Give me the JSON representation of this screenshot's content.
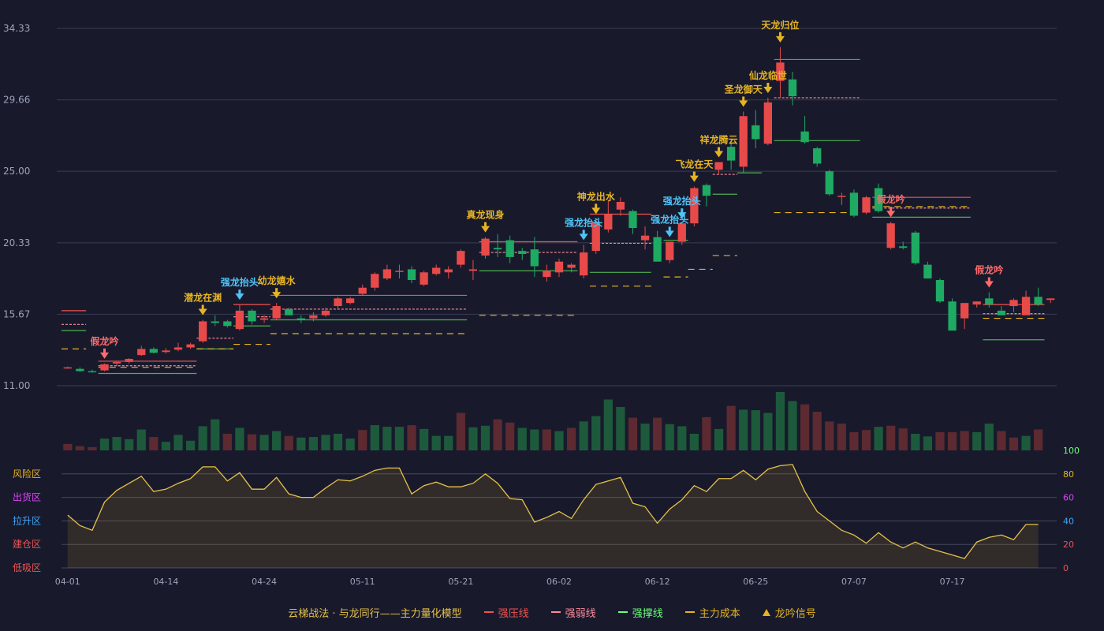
{
  "chart_data": {
    "type": "candlestick",
    "dates": [
      "04-01",
      "04-02",
      "04-03",
      "04-07",
      "04-08",
      "04-09",
      "04-10",
      "04-11",
      "04-14",
      "04-15",
      "04-16",
      "04-17",
      "04-18",
      "04-21",
      "04-22",
      "04-23",
      "04-24",
      "04-25",
      "04-28",
      "04-29",
      "04-30",
      "05-06",
      "05-07",
      "05-08",
      "05-09",
      "05-11",
      "05-12",
      "05-13",
      "05-14",
      "05-15",
      "05-16",
      "05-19",
      "05-20",
      "05-21",
      "05-22",
      "05-23",
      "05-26",
      "05-27",
      "05-28",
      "05-29",
      "05-30",
      "06-02",
      "06-03",
      "06-04",
      "06-05",
      "06-06",
      "06-09",
      "06-10",
      "06-11",
      "06-12",
      "06-13",
      "06-16",
      "06-17",
      "06-18",
      "06-19",
      "06-20",
      "06-23",
      "06-24",
      "06-25",
      "06-26",
      "06-27",
      "06-30",
      "07-01",
      "07-02",
      "07-03",
      "07-04",
      "07-07",
      "07-08",
      "07-09",
      "07-10",
      "07-11",
      "07-14",
      "07-15",
      "07-16",
      "07-17",
      "07-18",
      "07-21",
      "07-22",
      "07-23",
      "07-24",
      "07-25"
    ],
    "x_ticks": [
      {
        "i": 0,
        "label": "04-01"
      },
      {
        "i": 8,
        "label": "04-14"
      },
      {
        "i": 16,
        "label": "04-24"
      },
      {
        "i": 24,
        "label": "05-11"
      },
      {
        "i": 32,
        "label": "05-21"
      },
      {
        "i": 40,
        "label": "06-02"
      },
      {
        "i": 48,
        "label": "06-12"
      },
      {
        "i": 56,
        "label": "06-25"
      },
      {
        "i": 64,
        "label": "07-07"
      },
      {
        "i": 72,
        "label": "07-17"
      }
    ],
    "ohlc": [
      [
        12.2,
        12.25,
        12.1,
        12.2
      ],
      [
        12.1,
        12.2,
        11.9,
        11.95
      ],
      [
        11.95,
        12.05,
        11.85,
        11.9
      ],
      [
        12.0,
        12.45,
        11.95,
        12.4
      ],
      [
        12.45,
        12.6,
        12.3,
        12.55
      ],
      [
        12.55,
        12.8,
        12.45,
        12.75
      ],
      [
        13.0,
        13.6,
        12.95,
        13.4
      ],
      [
        13.4,
        13.5,
        13.1,
        13.15
      ],
      [
        13.2,
        13.45,
        13.1,
        13.3
      ],
      [
        13.35,
        13.8,
        13.25,
        13.5
      ],
      [
        13.5,
        13.8,
        13.4,
        13.7
      ],
      [
        13.9,
        15.3,
        13.8,
        15.2
      ],
      [
        15.2,
        15.6,
        14.9,
        15.1
      ],
      [
        15.2,
        15.3,
        14.8,
        14.9
      ],
      [
        14.7,
        16.3,
        14.6,
        15.9
      ],
      [
        15.9,
        16.0,
        15.0,
        15.2
      ],
      [
        15.3,
        15.6,
        15.1,
        15.4
      ],
      [
        15.4,
        16.4,
        15.3,
        16.2
      ],
      [
        16.0,
        16.1,
        15.6,
        15.6
      ],
      [
        15.4,
        15.6,
        15.1,
        15.3
      ],
      [
        15.4,
        15.8,
        15.2,
        15.6
      ],
      [
        15.6,
        16.1,
        15.5,
        15.9
      ],
      [
        16.2,
        16.8,
        16.0,
        16.7
      ],
      [
        16.4,
        16.8,
        16.3,
        16.7
      ],
      [
        17.0,
        17.6,
        16.9,
        17.4
      ],
      [
        17.4,
        18.4,
        17.2,
        18.3
      ],
      [
        18.0,
        18.9,
        17.9,
        18.6
      ],
      [
        18.5,
        18.9,
        18.0,
        18.5
      ],
      [
        18.6,
        18.8,
        17.7,
        17.9
      ],
      [
        17.6,
        18.5,
        17.5,
        18.4
      ],
      [
        18.3,
        18.9,
        18.2,
        18.7
      ],
      [
        18.4,
        18.8,
        18.0,
        18.6
      ],
      [
        18.9,
        19.9,
        18.7,
        19.8
      ],
      [
        18.5,
        19.2,
        17.9,
        18.6
      ],
      [
        19.5,
        20.7,
        19.3,
        20.6
      ],
      [
        20.0,
        20.9,
        19.4,
        19.9
      ],
      [
        20.5,
        20.8,
        19.0,
        19.4
      ],
      [
        19.8,
        20.0,
        19.2,
        19.6
      ],
      [
        19.9,
        20.7,
        18.1,
        18.8
      ],
      [
        18.1,
        18.9,
        17.8,
        18.5
      ],
      [
        18.4,
        19.3,
        18.1,
        19.1
      ],
      [
        18.7,
        19.0,
        18.4,
        18.9
      ],
      [
        18.2,
        20.2,
        18.0,
        19.7
      ],
      [
        19.8,
        21.9,
        19.6,
        21.7
      ],
      [
        21.2,
        23.1,
        21.0,
        22.2
      ],
      [
        22.5,
        23.3,
        22.1,
        23.0
      ],
      [
        22.4,
        22.5,
        20.9,
        21.3
      ],
      [
        20.5,
        21.4,
        19.9,
        20.8
      ],
      [
        20.7,
        21.1,
        19.4,
        19.1
      ],
      [
        19.2,
        20.4,
        19.0,
        20.4
      ],
      [
        20.4,
        21.6,
        20.2,
        21.6
      ],
      [
        21.6,
        24.0,
        21.4,
        23.9
      ],
      [
        24.1,
        24.2,
        22.7,
        23.4
      ],
      [
        25.1,
        25.6,
        24.8,
        25.6
      ],
      [
        26.6,
        26.9,
        25.1,
        25.7
      ],
      [
        25.3,
        28.9,
        24.9,
        28.6
      ],
      [
        28.0,
        29.0,
        26.5,
        27.1
      ],
      [
        26.8,
        29.8,
        26.7,
        29.5
      ],
      [
        30.9,
        33.1,
        29.8,
        32.1
      ],
      [
        31.0,
        31.5,
        29.3,
        29.9
      ],
      [
        27.6,
        28.6,
        26.8,
        26.9
      ],
      [
        26.5,
        26.6,
        25.3,
        25.5
      ],
      [
        25.0,
        25.1,
        23.4,
        23.5
      ],
      [
        23.4,
        23.6,
        22.8,
        23.4
      ],
      [
        23.6,
        23.8,
        22.0,
        22.1
      ],
      [
        22.3,
        23.4,
        22.2,
        23.3
      ],
      [
        23.9,
        24.2,
        22.3,
        22.4
      ],
      [
        20.0,
        21.7,
        19.9,
        21.6
      ],
      [
        20.1,
        20.4,
        19.9,
        20.0
      ],
      [
        21.0,
        21.1,
        18.9,
        19.0
      ],
      [
        18.9,
        19.1,
        18.0,
        18.0
      ],
      [
        17.9,
        18.0,
        16.4,
        16.5
      ],
      [
        16.5,
        16.7,
        14.6,
        14.6
      ],
      [
        15.4,
        15.9,
        14.7,
        16.4
      ],
      [
        16.3,
        16.5,
        16.1,
        16.5
      ],
      [
        16.7,
        17.1,
        16.1,
        16.3
      ],
      [
        15.9,
        16.2,
        15.6,
        15.6
      ],
      [
        16.2,
        16.7,
        15.8,
        16.6
      ],
      [
        15.6,
        17.2,
        15.7,
        16.8
      ],
      [
        16.8,
        17.4,
        16.2,
        16.3
      ],
      [
        16.6,
        16.7,
        16.4,
        16.7
      ]
    ],
    "volume": [
      [
        1.2,
        0
      ],
      [
        0.8,
        0
      ],
      [
        0.6,
        0
      ],
      [
        2.2,
        1
      ],
      [
        2.5,
        1
      ],
      [
        2.1,
        1
      ],
      [
        3.9,
        1
      ],
      [
        2.5,
        0
      ],
      [
        1.6,
        1
      ],
      [
        2.9,
        1
      ],
      [
        1.8,
        1
      ],
      [
        4.5,
        1
      ],
      [
        5.8,
        1
      ],
      [
        3.1,
        0
      ],
      [
        4.2,
        1
      ],
      [
        3.0,
        0
      ],
      [
        2.9,
        1
      ],
      [
        3.6,
        1
      ],
      [
        2.7,
        0
      ],
      [
        2.4,
        1
      ],
      [
        2.5,
        1
      ],
      [
        2.9,
        1
      ],
      [
        3.1,
        1
      ],
      [
        2.2,
        1
      ],
      [
        3.8,
        0
      ],
      [
        4.7,
        1
      ],
      [
        4.4,
        1
      ],
      [
        4.4,
        1
      ],
      [
        4.7,
        0
      ],
      [
        4.0,
        1
      ],
      [
        2.7,
        1
      ],
      [
        2.7,
        1
      ],
      [
        7.0,
        0
      ],
      [
        4.3,
        1
      ],
      [
        4.6,
        1
      ],
      [
        5.8,
        0
      ],
      [
        5.2,
        0
      ],
      [
        4.2,
        1
      ],
      [
        3.9,
        1
      ],
      [
        3.9,
        0
      ],
      [
        3.6,
        1
      ],
      [
        4.2,
        0
      ],
      [
        5.4,
        1
      ],
      [
        6.4,
        1
      ],
      [
        9.5,
        1
      ],
      [
        8.1,
        1
      ],
      [
        6.1,
        0
      ],
      [
        5.0,
        1
      ],
      [
        6.1,
        0
      ],
      [
        4.9,
        1
      ],
      [
        4.5,
        1
      ],
      [
        3.1,
        1
      ],
      [
        6.2,
        0
      ],
      [
        4.0,
        1
      ],
      [
        8.3,
        0
      ],
      [
        7.6,
        1
      ],
      [
        7.5,
        1
      ],
      [
        7.0,
        1
      ],
      [
        10.9,
        1
      ],
      [
        9.2,
        1
      ],
      [
        8.6,
        0
      ],
      [
        7.2,
        0
      ],
      [
        5.4,
        0
      ],
      [
        5.0,
        0
      ],
      [
        3.4,
        0
      ],
      [
        3.8,
        0
      ],
      [
        4.4,
        1
      ],
      [
        4.6,
        0
      ],
      [
        4.1,
        0
      ],
      [
        3.1,
        1
      ],
      [
        2.6,
        1
      ],
      [
        3.4,
        0
      ],
      [
        3.4,
        0
      ],
      [
        3.6,
        0
      ],
      [
        3.4,
        1
      ],
      [
        5.0,
        1
      ],
      [
        3.6,
        0
      ],
      [
        2.4,
        0
      ],
      [
        2.7,
        1
      ],
      [
        3.9,
        0
      ]
    ],
    "indicator": [
      45,
      36,
      32,
      56,
      66,
      72,
      78,
      65,
      67,
      72,
      76,
      86,
      86,
      74,
      81,
      67,
      67,
      77,
      63,
      60,
      60,
      68,
      75,
      74,
      78,
      83,
      85,
      85,
      63,
      70,
      73,
      69,
      69,
      72,
      80,
      72,
      59,
      58,
      39,
      43,
      48,
      42,
      58,
      71,
      74,
      77,
      55,
      52,
      38,
      50,
      58,
      70,
      65,
      76,
      76,
      83,
      75,
      84,
      87,
      88,
      65,
      48,
      40,
      32,
      28,
      21,
      30,
      22,
      17,
      22,
      17,
      14,
      11,
      8,
      22,
      26,
      28,
      24,
      37,
      37
    ],
    "y_ticks": [
      "34.33",
      "29.66",
      "25.00",
      "20.33",
      "15.67",
      "11.00"
    ],
    "y_range": [
      11.0,
      34.33
    ],
    "indicator_ticks": [
      "0",
      "20",
      "40",
      "60",
      "80",
      "100"
    ],
    "zones": [
      {
        "label": "风险区",
        "value": 80,
        "color": "#e6b422"
      },
      {
        "label": "出货区",
        "value": 60,
        "color": "#e040fb"
      },
      {
        "label": "拉升区",
        "value": 40,
        "color": "#42a5f5"
      },
      {
        "label": "建仓区",
        "value": 20,
        "color": "#ef5350"
      },
      {
        "label": "低吸区",
        "value": 0,
        "color": "#ef5350"
      }
    ],
    "signals": [
      {
        "i": 3,
        "label": "假龙吟",
        "color": "#ff6b6b"
      },
      {
        "i": 11,
        "label": "潜龙在渊",
        "color": "#e6b422"
      },
      {
        "i": 14,
        "label": "强龙抬头",
        "color": "#4fc3f7"
      },
      {
        "i": 17,
        "label": "幼龙嬉水",
        "color": "#e6b422"
      },
      {
        "i": 34,
        "label": "真龙现身",
        "color": "#e6b422"
      },
      {
        "i": 42,
        "label": "强龙抬头",
        "color": "#4fc3f7"
      },
      {
        "i": 43,
        "label": "神龙出水",
        "color": "#e6b422"
      },
      {
        "i": 49,
        "label": "强龙抬头",
        "color": "#4fc3f7"
      },
      {
        "i": 50,
        "label": "强龙抬头",
        "color": "#4fc3f7"
      },
      {
        "i": 51,
        "label": "飞龙在天",
        "color": "#e6b422"
      },
      {
        "i": 53,
        "label": "祥龙腾云",
        "color": "#e6b422"
      },
      {
        "i": 55,
        "label": "圣龙御天",
        "color": "#e6b422"
      },
      {
        "i": 57,
        "label": "仙龙临世",
        "color": "#e6b422"
      },
      {
        "i": 58,
        "label": "天龙归位",
        "color": "#e6b422"
      },
      {
        "i": 67,
        "label": "假龙吟",
        "color": "#ff6b6b"
      },
      {
        "i": 75,
        "label": "假龙吟",
        "color": "#ff6b6b"
      }
    ],
    "levels": {
      "pressure": [
        [
          0,
          1,
          15.9
        ],
        [
          3,
          10,
          12.6
        ],
        [
          14,
          16,
          16.3
        ],
        [
          17,
          32,
          16.9
        ],
        [
          34,
          41,
          20.4
        ],
        [
          43,
          47,
          22.2
        ],
        [
          58,
          64,
          32.3
        ],
        [
          66,
          73,
          23.3
        ],
        [
          75,
          79,
          16.3
        ]
      ],
      "weak": [
        [
          0,
          1,
          15.0
        ],
        [
          3,
          10,
          12.3
        ],
        [
          11,
          13,
          14.1
        ],
        [
          14,
          16,
          15.5
        ],
        [
          17,
          32,
          16.0
        ],
        [
          34,
          41,
          19.7
        ],
        [
          43,
          47,
          20.3
        ],
        [
          53,
          54,
          24.8
        ],
        [
          58,
          64,
          29.8
        ],
        [
          66,
          73,
          22.6
        ],
        [
          75,
          79,
          15.7
        ]
      ],
      "support": [
        [
          0,
          1,
          14.6
        ],
        [
          3,
          10,
          11.8
        ],
        [
          11,
          13,
          13.4
        ],
        [
          14,
          16,
          14.9
        ],
        [
          17,
          32,
          15.3
        ],
        [
          34,
          41,
          18.5
        ],
        [
          43,
          47,
          18.4
        ],
        [
          49,
          50,
          20.5
        ],
        [
          53,
          54,
          23.5
        ],
        [
          55,
          56,
          24.9
        ],
        [
          58,
          64,
          27.0
        ],
        [
          66,
          73,
          22.0
        ],
        [
          75,
          79,
          14.0
        ]
      ],
      "cost": [
        [
          0,
          1,
          13.4
        ],
        [
          3,
          10,
          12.2
        ],
        [
          11,
          13,
          13.4
        ],
        [
          14,
          16,
          13.7
        ],
        [
          17,
          32,
          14.4
        ],
        [
          34,
          41,
          15.6
        ],
        [
          43,
          47,
          17.5
        ],
        [
          49,
          50,
          18.1
        ],
        [
          51,
          52,
          18.6
        ],
        [
          53,
          54,
          19.5
        ],
        [
          58,
          64,
          22.3
        ],
        [
          66,
          73,
          22.7
        ],
        [
          75,
          79,
          15.4
        ]
      ]
    },
    "colors": {
      "up": "#e84a4a",
      "down": "#1eaa62",
      "pressure": "#ef5350",
      "weak": "#ff8a9a",
      "support": "#4caf50",
      "cost": "#e6b422"
    }
  },
  "legend": {
    "title": "云梯战法 · 与龙同行——主力量化模型",
    "items": [
      {
        "label": "强压线",
        "color": "#ef5350",
        "style": "solid"
      },
      {
        "label": "强弱线",
        "color": "#ff8a9a",
        "style": "dash"
      },
      {
        "label": "强撑线",
        "color": "#6cff7a",
        "style": "solid"
      },
      {
        "label": "主力成本",
        "color": "#e6b422",
        "style": "dash"
      },
      {
        "label": "龙吟信号",
        "color": "#e6b422",
        "style": "tri"
      }
    ]
  }
}
